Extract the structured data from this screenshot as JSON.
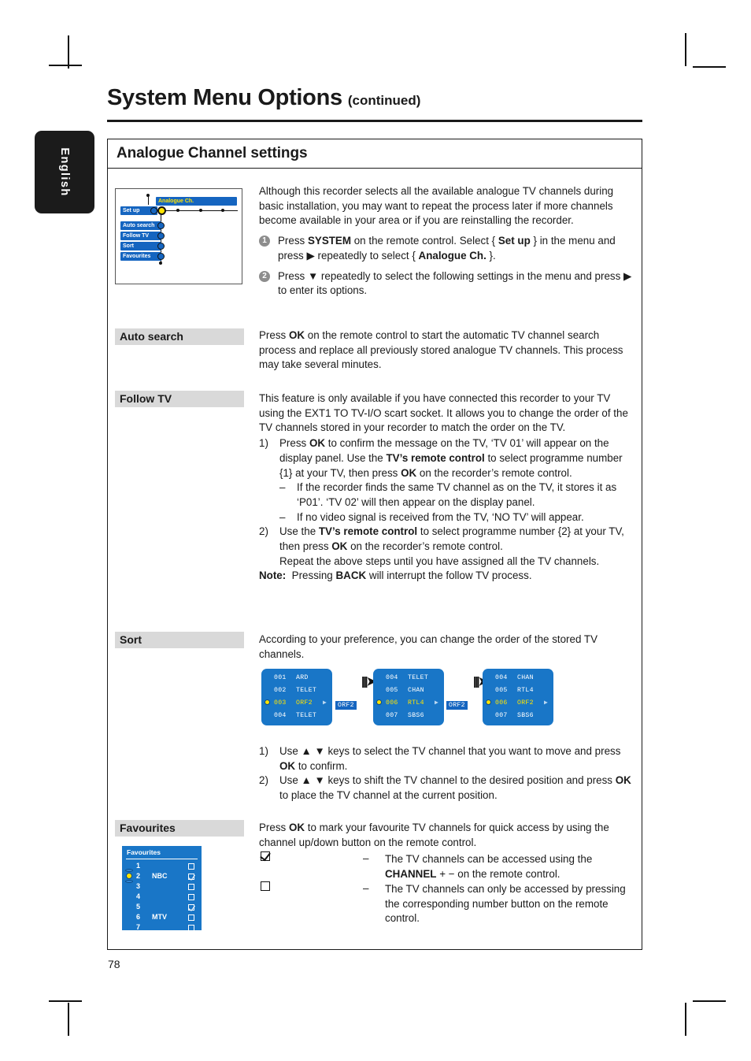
{
  "page": {
    "number": "78",
    "language_tab": "English",
    "title": "System Menu Options",
    "title_continued": "(continued)",
    "section_title": "Analogue Channel settings"
  },
  "menu_picture": {
    "header": "Analogue Ch.",
    "items": [
      "Set up",
      "Auto search",
      "Follow TV",
      "Sort",
      "Favourites"
    ]
  },
  "intro": {
    "paragraph": "Although this recorder selects all the available analogue TV channels during basic installation, you may want to repeat the process later if more channels become available in your area or if you are reinstalling the recorder.",
    "steps": [
      {
        "num": "1",
        "html": "Press <b>SYSTEM</b> on the remote control. Select { <b>Set up</b> } in the menu and press ▶ repeatedly to select { <b>Analogue Ch.</b> }."
      },
      {
        "num": "2",
        "html": "Press ▼ repeatedly to select the following settings in the menu and press ▶ to enter its options."
      }
    ]
  },
  "sections": {
    "auto_search": {
      "label": "Auto search",
      "html": "Press <b>OK</b> on the remote control to start the automatic TV channel search process and replace all previously stored analogue TV channels. This process may take several minutes."
    },
    "follow_tv": {
      "label": "Follow TV",
      "intro_html": "This feature is only available if you have connected this recorder to your TV using the EXT1 TO TV-I/O scart socket. It allows you to change the order of the TV channels stored in your recorder to match the order on the TV.",
      "step1_num": "1)",
      "step1_html": "Press <b>OK</b> to confirm the message on the TV, ‘TV 01’ will appear on the display panel. Use the <b>TV’s remote control</b> to select programme number {1} at your TV, then press <b>OK</b> on the recorder’s remote control.",
      "step1_dashes": [
        "If the recorder finds the same TV channel as on the TV, it stores it as ‘P01’. ‘TV 02’ will then appear on the display panel.",
        "If no video signal is received from the TV, ‘NO TV’ will appear."
      ],
      "step2_num": "2)",
      "step2_html": "Use the <b>TV’s remote control</b> to select programme number {2} at your TV, then press <b>OK</b> on the recorder’s remote control.<br>Repeat the above steps until you have assigned all the TV channels.",
      "note_html": "<b>Note:</b>&nbsp; Pressing <b>BACK</b> will interrupt the follow TV process."
    },
    "sort": {
      "label": "Sort",
      "intro_html": "According to your preference, you can change the order of the stored TV channels.",
      "steps": [
        {
          "num": "1)",
          "html": "Use ▲ ▼ keys to select the TV channel that you want to move and press <b>OK</b> to confirm."
        },
        {
          "num": "2)",
          "html": "Use ▲ ▼ keys to shift the TV channel to the desired position and press <b>OK</b> to place the TV channel at the current position."
        }
      ],
      "panels": [
        {
          "rows": [
            {
              "num": "001",
              "name": "ARD",
              "selected": false
            },
            {
              "num": "002",
              "name": "TELET",
              "selected": false
            },
            {
              "num": "003",
              "name": "ORF2",
              "selected": true
            },
            {
              "num": "004",
              "name": "TELET",
              "selected": false
            }
          ],
          "chip": "ORF2"
        },
        {
          "rows": [
            {
              "num": "004",
              "name": "TELET",
              "selected": false
            },
            {
              "num": "005",
              "name": "CHAN",
              "selected": false
            },
            {
              "num": "006",
              "name": "RTL4",
              "selected": true
            },
            {
              "num": "007",
              "name": "SBS6",
              "selected": false
            }
          ],
          "chip": "ORF2"
        },
        {
          "rows": [
            {
              "num": "004",
              "name": "CHAN",
              "selected": false
            },
            {
              "num": "005",
              "name": "RTL4",
              "selected": false
            },
            {
              "num": "006",
              "name": "ORF2",
              "selected": true
            },
            {
              "num": "007",
              "name": "SBS6",
              "selected": false
            }
          ],
          "chip": ""
        }
      ]
    },
    "favourites": {
      "label": "Favourites",
      "intro_html": "Press <b>OK</b> to mark your favourite TV channels for quick access by using the channel up/down button on the remote control.",
      "legend": [
        {
          "checked": true,
          "dash": "–",
          "html": "The TV channels can be accessed using the <b>CHANNEL</b> + − on the remote control."
        },
        {
          "checked": false,
          "dash": "–",
          "html": "The TV channels can only be accessed by pressing the corresponding number button on the remote control."
        }
      ],
      "panel": {
        "title": "Favourites",
        "rows": [
          {
            "num": "1",
            "name": "",
            "checked": false
          },
          {
            "num": "2",
            "name": "NBC",
            "checked": true
          },
          {
            "num": "3",
            "name": "",
            "checked": false
          },
          {
            "num": "4",
            "name": "",
            "checked": false
          },
          {
            "num": "5",
            "name": "",
            "checked": true
          },
          {
            "num": "6",
            "name": "MTV",
            "checked": false
          },
          {
            "num": "7",
            "name": "",
            "checked": false
          }
        ]
      }
    }
  }
}
